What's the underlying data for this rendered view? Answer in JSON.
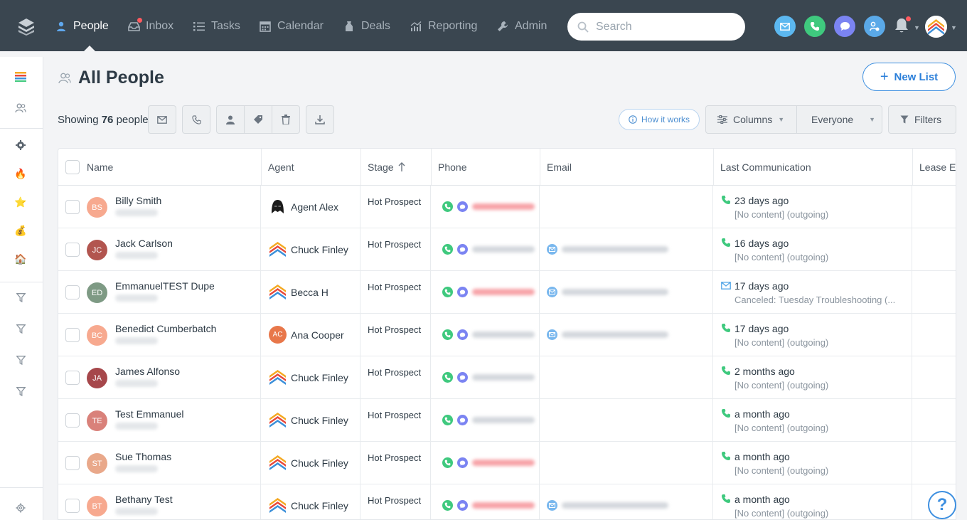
{
  "nav": {
    "items": [
      {
        "label": "People",
        "icon": "person-icon",
        "active": true
      },
      {
        "label": "Inbox",
        "icon": "inbox-icon",
        "active": false
      },
      {
        "label": "Tasks",
        "icon": "tasks-icon",
        "active": false
      },
      {
        "label": "Calendar",
        "icon": "calendar-icon",
        "active": false
      },
      {
        "label": "Deals",
        "icon": "deals-icon",
        "active": false
      },
      {
        "label": "Reporting",
        "icon": "reporting-icon",
        "active": false
      },
      {
        "label": "Admin",
        "icon": "wrench-icon",
        "active": false
      }
    ],
    "search_placeholder": "Search"
  },
  "header": {
    "title": "All People",
    "new_list_label": "New List"
  },
  "toolbar": {
    "showing_prefix": "Showing",
    "showing_count": "76",
    "showing_suffix": "people",
    "how_it_works": "How it works",
    "columns_label": "Columns",
    "owner_filter": "Everyone",
    "filters_label": "Filters"
  },
  "table": {
    "columns": {
      "name": "Name",
      "agent": "Agent",
      "stage": "Stage",
      "phone": "Phone",
      "email": "Email",
      "last_communication": "Last Communication",
      "lease": "Lease Ex"
    },
    "rows": [
      {
        "initials": "BS",
        "name": "Billy Smith",
        "avatar_color": "#f7a98f",
        "agent": "Agent Alex",
        "agent_icon": "darth-vader",
        "stage": "Hot Prospect",
        "phone_red": true,
        "has_email": false,
        "lc_type": "call",
        "lc_time": "23 days ago",
        "lc_detail": "[No content] (outgoing)"
      },
      {
        "initials": "JC",
        "name": "Jack Carlson",
        "avatar_color": "#b2554f",
        "agent": "Chuck Finley",
        "agent_icon": "logo",
        "stage": "Hot Prospect",
        "phone_red": false,
        "has_email": true,
        "lc_type": "call",
        "lc_time": "16 days ago",
        "lc_detail": "[No content] (outgoing)"
      },
      {
        "initials": "ED",
        "name": "EmmanuelTEST Dupe",
        "avatar_color": "#7e9a84",
        "agent": "Becca H",
        "agent_icon": "logo",
        "stage": "Hot Prospect",
        "phone_red": true,
        "has_email": true,
        "lc_type": "email",
        "lc_time": "17 days ago",
        "lc_detail": "Canceled: Tuesday Troubleshooting (..."
      },
      {
        "initials": "BC",
        "name": "Benedict Cumberbatch",
        "avatar_color": "#f7a98f",
        "agent": "Ana Cooper",
        "agent_icon": "ac",
        "stage": "Hot Prospect",
        "phone_red": false,
        "has_email": true,
        "lc_type": "call",
        "lc_time": "17 days ago",
        "lc_detail": "[No content] (outgoing)"
      },
      {
        "initials": "JA",
        "name": "James Alfonso",
        "avatar_color": "#a6474b",
        "agent": "Chuck Finley",
        "agent_icon": "logo",
        "stage": "Hot Prospect",
        "phone_red": false,
        "has_email": false,
        "lc_type": "call",
        "lc_time": "2 months ago",
        "lc_detail": "[No content] (outgoing)"
      },
      {
        "initials": "TE",
        "name": "Test Emmanuel",
        "avatar_color": "#d9817a",
        "agent": "Chuck Finley",
        "agent_icon": "logo",
        "stage": "Hot Prospect",
        "phone_red": false,
        "has_email": false,
        "lc_type": "call",
        "lc_time": "a month ago",
        "lc_detail": "[No content] (outgoing)"
      },
      {
        "initials": "ST",
        "name": "Sue Thomas",
        "avatar_color": "#e9a88a",
        "agent": "Chuck Finley",
        "agent_icon": "logo",
        "stage": "Hot Prospect",
        "phone_red": true,
        "has_email": false,
        "lc_type": "call",
        "lc_time": "a month ago",
        "lc_detail": "[No content] (outgoing)"
      },
      {
        "initials": "BT",
        "name": "Bethany Test",
        "avatar_color": "#f7a98f",
        "agent": "Chuck Finley",
        "agent_icon": "logo",
        "stage": "Hot Prospect",
        "phone_red": true,
        "has_email": true,
        "lc_type": "call",
        "lc_time": "a month ago",
        "lc_detail": "[No content] (outgoing)"
      }
    ]
  },
  "help_label": "?",
  "colors": {
    "topbar": "#3a4650",
    "accent": "#3d8fe0",
    "call_green": "#3fc97e",
    "chat_purple": "#7b84f2"
  }
}
